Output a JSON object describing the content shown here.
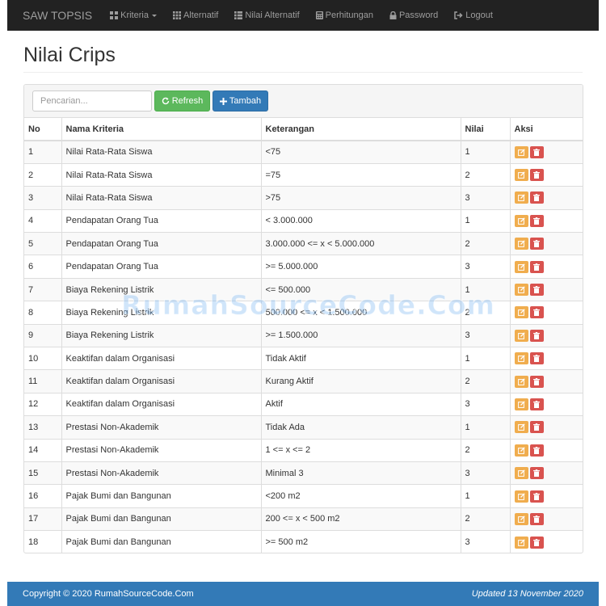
{
  "navbar": {
    "brand": "SAW TOPSIS",
    "items": [
      {
        "label": "Kriteria",
        "icon": "th-large-icon",
        "dropdown": true
      },
      {
        "label": "Alternatif",
        "icon": "th-icon",
        "dropdown": false
      },
      {
        "label": "Nilai Alternatif",
        "icon": "th-list-icon",
        "dropdown": false
      },
      {
        "label": "Perhitungan",
        "icon": "calculator-icon",
        "dropdown": false
      },
      {
        "label": "Password",
        "icon": "lock-icon",
        "dropdown": false
      },
      {
        "label": "Logout",
        "icon": "logout-icon",
        "dropdown": false
      }
    ]
  },
  "page": {
    "title": "Nilai Crips"
  },
  "toolbar": {
    "search_placeholder": "Pencarian...",
    "refresh_label": "Refresh",
    "add_label": "Tambah"
  },
  "table": {
    "headers": [
      "No",
      "Nama Kriteria",
      "Keterangan",
      "Nilai",
      "Aksi"
    ],
    "rows": [
      {
        "no": "1",
        "kriteria": "Nilai Rata-Rata Siswa",
        "keterangan": "<75",
        "nilai": "1"
      },
      {
        "no": "2",
        "kriteria": "Nilai Rata-Rata Siswa",
        "keterangan": "=75",
        "nilai": "2"
      },
      {
        "no": "3",
        "kriteria": "Nilai Rata-Rata Siswa",
        "keterangan": ">75",
        "nilai": "3"
      },
      {
        "no": "4",
        "kriteria": "Pendapatan Orang Tua",
        "keterangan": "< 3.000.000",
        "nilai": "1"
      },
      {
        "no": "5",
        "kriteria": "Pendapatan Orang Tua",
        "keterangan": "3.000.000 <= x < 5.000.000",
        "nilai": "2"
      },
      {
        "no": "6",
        "kriteria": "Pendapatan Orang Tua",
        "keterangan": ">= 5.000.000",
        "nilai": "3"
      },
      {
        "no": "7",
        "kriteria": "Biaya Rekening Listrik",
        "keterangan": "<= 500.000",
        "nilai": "1"
      },
      {
        "no": "8",
        "kriteria": "Biaya Rekening Listrik",
        "keterangan": "500.000 <= x < 1.500.000",
        "nilai": "2"
      },
      {
        "no": "9",
        "kriteria": "Biaya Rekening Listrik",
        "keterangan": ">= 1.500.000",
        "nilai": "3"
      },
      {
        "no": "10",
        "kriteria": "Keaktifan dalam Organisasi",
        "keterangan": "Tidak Aktif",
        "nilai": "1"
      },
      {
        "no": "11",
        "kriteria": "Keaktifan dalam Organisasi",
        "keterangan": "Kurang Aktif",
        "nilai": "2"
      },
      {
        "no": "12",
        "kriteria": "Keaktifan dalam Organisasi",
        "keterangan": "Aktif",
        "nilai": "3"
      },
      {
        "no": "13",
        "kriteria": "Prestasi Non-Akademik",
        "keterangan": "Tidak Ada",
        "nilai": "1"
      },
      {
        "no": "14",
        "kriteria": "Prestasi Non-Akademik",
        "keterangan": "1 <= x <= 2",
        "nilai": "2"
      },
      {
        "no": "15",
        "kriteria": "Prestasi Non-Akademik",
        "keterangan": "Minimal 3",
        "nilai": "3"
      },
      {
        "no": "16",
        "kriteria": "Pajak Bumi dan Bangunan",
        "keterangan": "<200 m2",
        "nilai": "1"
      },
      {
        "no": "17",
        "kriteria": "Pajak Bumi dan Bangunan",
        "keterangan": "200 <= x < 500 m2",
        "nilai": "2"
      },
      {
        "no": "18",
        "kriteria": "Pajak Bumi dan Bangunan",
        "keterangan": ">= 500 m2",
        "nilai": "3"
      }
    ]
  },
  "watermark": "RumahSourceCode.Com",
  "footer": {
    "copyright": "Copyright © 2020 RumahSourceCode.Com",
    "updated": "Updated 13 November 2020"
  },
  "colors": {
    "navbar_bg": "#222222",
    "refresh_btn": "#5cb85c",
    "add_btn": "#337ab7",
    "edit_btn": "#f0ad4e",
    "delete_btn": "#d9534f",
    "footer_bg": "#337ab7"
  }
}
